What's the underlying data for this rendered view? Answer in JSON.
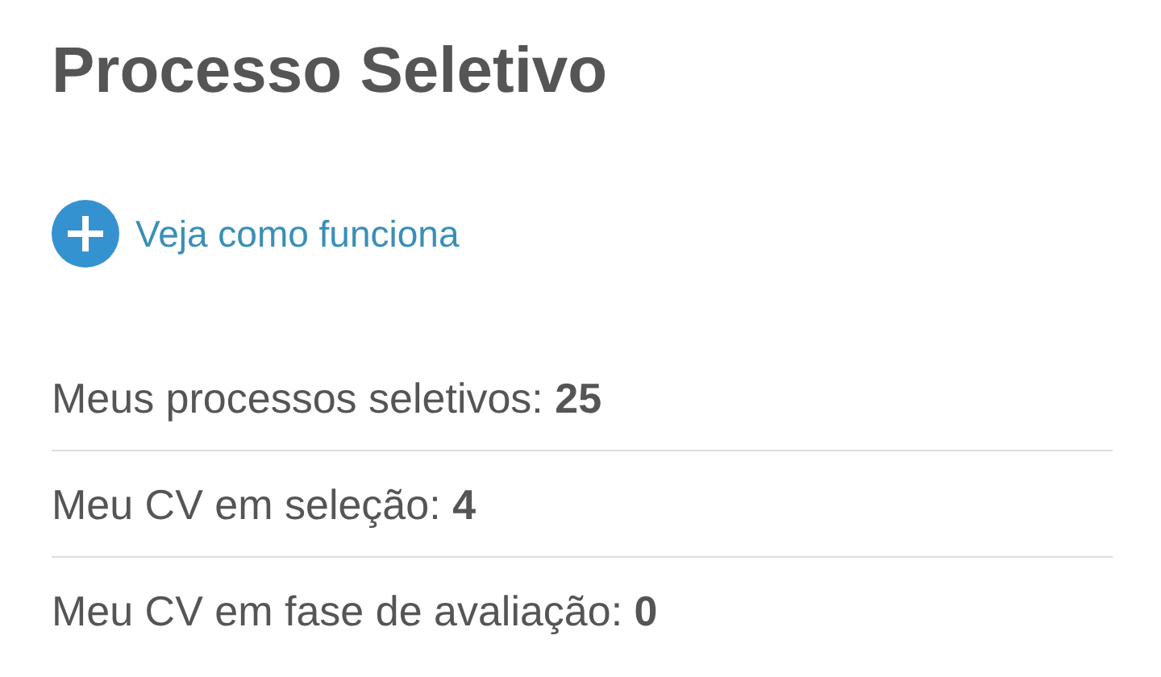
{
  "title": "Processo Seletivo",
  "link": {
    "label": "Veja como funciona"
  },
  "stats": [
    {
      "text": "Meus processos seletivos: **25**"
    },
    {
      "text": "Meu CV em seleção: **4**"
    },
    {
      "text": "Meu CV em fase de avaliação: **0**"
    }
  ]
}
